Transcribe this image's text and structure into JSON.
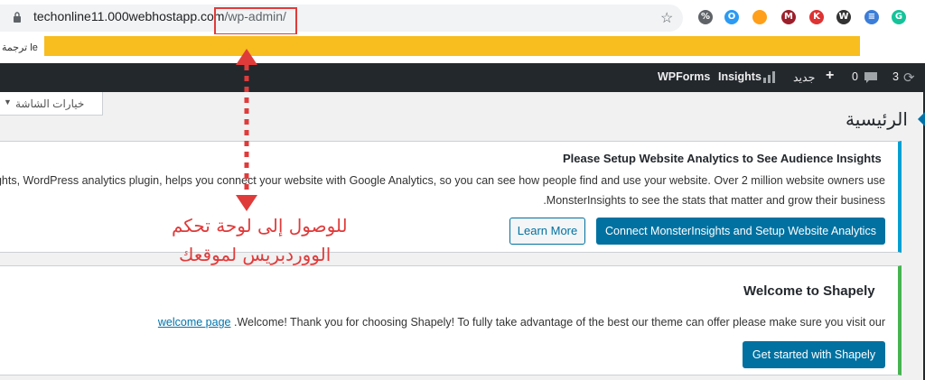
{
  "browser": {
    "url_host": "techonline11.000webhostapp.com",
    "url_path": "/wp-admin/",
    "extensions": [
      {
        "name": "link-extension-icon",
        "color": "#5f6368",
        "glyph": "%"
      },
      {
        "name": "chrome-color-extension-icon",
        "color": "#2b9af3",
        "glyph": "O"
      },
      {
        "name": "orange-extension-icon",
        "color": "#ff9f1a",
        "glyph": ""
      },
      {
        "name": "red-square-extension-icon",
        "color": "#9b1f2b",
        "glyph": "M"
      },
      {
        "name": "k-extension-icon",
        "color": "#d33",
        "glyph": "K"
      },
      {
        "name": "w-extension-icon",
        "color": "#333333",
        "glyph": "W"
      },
      {
        "name": "blue-extension-icon",
        "color": "#3b7dd8",
        "glyph": "≡"
      },
      {
        "name": "grammarly-extension-icon",
        "color": "#15c39a",
        "glyph": "G"
      }
    ]
  },
  "translate_bar": {
    "text": "ترجمة le"
  },
  "admin_bar": {
    "wpforms": "WPForms",
    "insights": "Insights",
    "new": "جديد",
    "comments_count": "0",
    "updates_count": "3"
  },
  "screen_options": {
    "label": "خيارات الشاشة"
  },
  "page": {
    "title": "الرئيسية"
  },
  "notice_analytics": {
    "title": "Please Setup Website Analytics to See Audience Insights",
    "line1": "ghts, WordPress analytics plugin, helps you connect your website with Google Analytics, so you can see how people find and use your website. Over 2 million website owners use",
    "line2": ".MonsterInsights to see the stats that matter and grow their business",
    "learn_more": "Learn More",
    "connect": "Connect MonsterInsights and Setup Website Analytics"
  },
  "notice_theme": {
    "title": "Welcome to Shapely",
    "text": ".Welcome! Thank you for choosing Shapely! To fully take advantage of the best our theme can offer please make sure you visit our",
    "link": "welcome page",
    "button": "Get started with Shapely"
  },
  "annotation": {
    "line1": "للوصول إلى لوحة تحكم",
    "line2": "الووردبريس لموقعك",
    "color": "#e03b3b"
  }
}
